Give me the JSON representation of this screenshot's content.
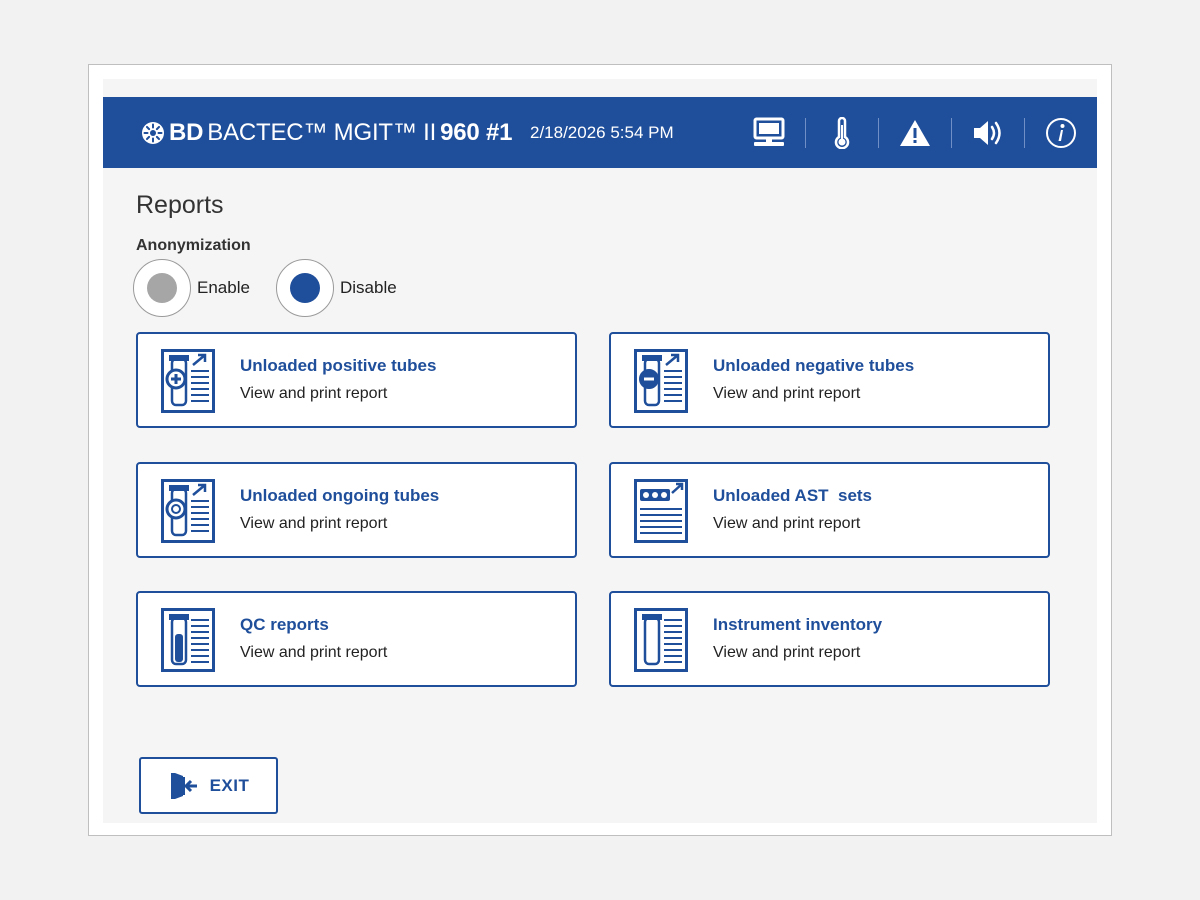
{
  "header": {
    "brand_bd": "BD",
    "brand_rest": "BACTEC™ MGIT™ II",
    "brand_model": "960 #1",
    "datetime": "2/18/2026 5:54 PM",
    "icons": [
      "computer-icon",
      "thermometer-icon",
      "warning-icon",
      "speaker-icon",
      "info-icon"
    ]
  },
  "page": {
    "title": "Reports",
    "anonymization": {
      "label": "Anonymization",
      "options": [
        {
          "label": "Enable",
          "selected": false
        },
        {
          "label": "Disable",
          "selected": true
        }
      ]
    }
  },
  "cards": [
    {
      "title": "Unloaded positive tubes",
      "subtitle": "View and print report",
      "icon": "positive-tube-report-icon"
    },
    {
      "title": "Unloaded negative tubes",
      "subtitle": "View and print report",
      "icon": "negative-tube-report-icon"
    },
    {
      "title": "Unloaded ongoing tubes",
      "subtitle": "View and print report",
      "icon": "ongoing-tube-report-icon"
    },
    {
      "title": "Unloaded AST  sets",
      "subtitle": "View and print report",
      "icon": "ast-set-report-icon"
    },
    {
      "title": "QC reports",
      "subtitle": "View and print report",
      "icon": "qc-tube-report-icon"
    },
    {
      "title": "Instrument inventory",
      "subtitle": "View and print report",
      "icon": "inventory-tube-report-icon"
    }
  ],
  "exit": {
    "label": "EXIT"
  },
  "colors": {
    "primary": "#1f4e9a",
    "radio_selected": "#1f4e9a",
    "radio_unselected": "#a6a6a6",
    "background": "#f5f5f5"
  }
}
